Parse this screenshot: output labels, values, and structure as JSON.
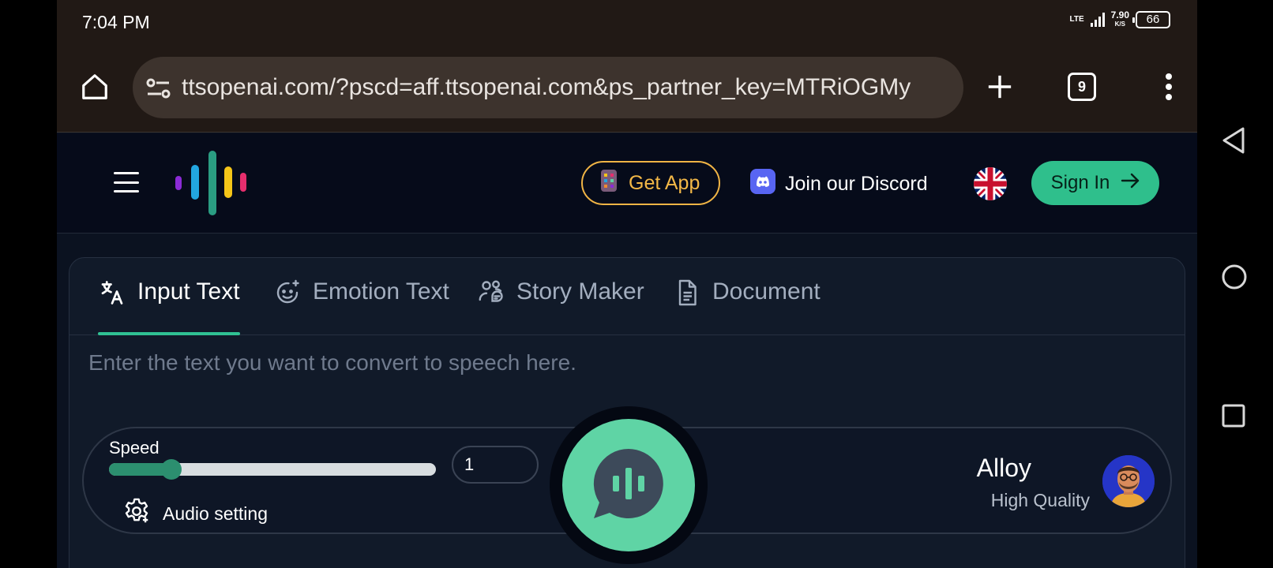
{
  "status_bar": {
    "time": "7:04 PM",
    "network": "LTE",
    "speed_value": "7.90",
    "speed_unit": "K/S",
    "battery": "66"
  },
  "browser": {
    "url": "ttsopenai.com/?pscd=aff.ttsopenai.com&ps_partner_key=MTRiOGMy",
    "tab_count": "9"
  },
  "header": {
    "get_app_label": "Get App",
    "discord_label": "Join our Discord",
    "sign_in_label": "Sign In"
  },
  "tabs": [
    {
      "label": "Input Text",
      "icon": "translate-icon",
      "active": true
    },
    {
      "label": "Emotion Text",
      "icon": "emotion-sparkle-icon",
      "active": false
    },
    {
      "label": "Story Maker",
      "icon": "users-chat-icon",
      "active": false
    },
    {
      "label": "Document",
      "icon": "document-icon",
      "active": false
    }
  ],
  "editor": {
    "placeholder": "Enter the text you want to convert to speech here.",
    "value": ""
  },
  "controls": {
    "speed_label": "Speed",
    "speed_value": "1",
    "speed_fraction": 0.19,
    "audio_setting_label": "Audio setting",
    "voice_name": "Alloy",
    "voice_quality": "High Quality"
  },
  "colors": {
    "accent": "#30c193",
    "get_app_border": "#f0b445",
    "play_button": "#5fd4a5"
  }
}
